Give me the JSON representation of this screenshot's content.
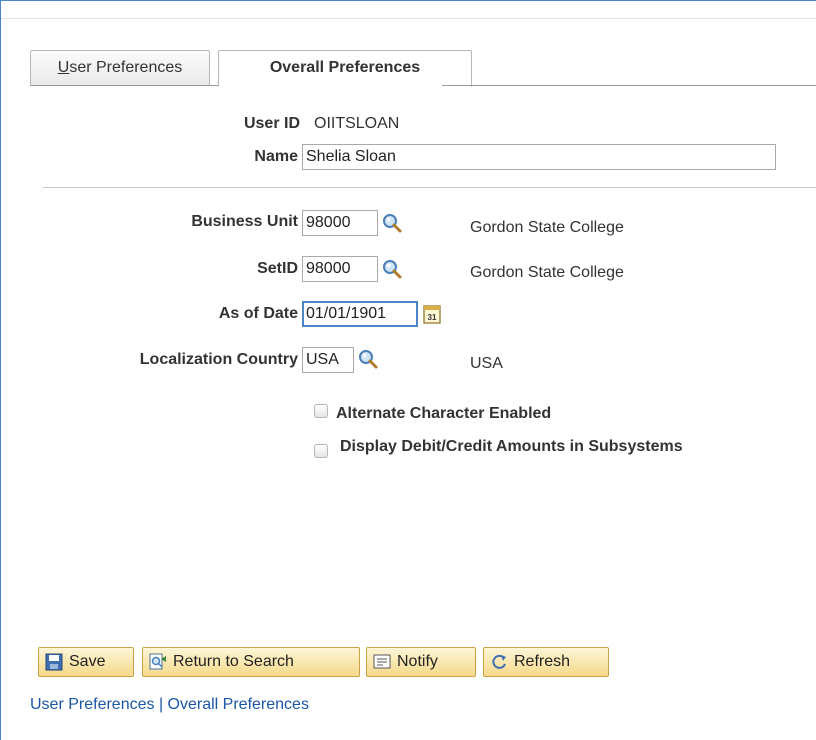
{
  "tabs": {
    "user_preferences": "User Preferences",
    "user_preferences_first": "U",
    "user_preferences_rest": "ser Preferences",
    "overall_preferences": "Overall Preferences"
  },
  "user": {
    "user_id_label": "User ID",
    "user_id_value": "OIITSLOAN",
    "name_label": "Name",
    "name_value": "Shelia Sloan"
  },
  "fields": {
    "business_unit_label": "Business Unit",
    "business_unit_value": "98000",
    "business_unit_desc": "Gordon State College",
    "setid_label": "SetID",
    "setid_value": "98000",
    "setid_desc": "Gordon State College",
    "as_of_date_label": "As of Date",
    "as_of_date_value": "01/01/1901",
    "localization_label": "Localization Country",
    "localization_value": "USA",
    "localization_desc": "USA"
  },
  "checkboxes": {
    "alternate_character": {
      "label": "Alternate Character Enabled",
      "checked": false
    },
    "display_debit_credit": {
      "label": "Display Debit/Credit Amounts in Subsystems",
      "checked": false
    }
  },
  "toolbar": {
    "save": "Save",
    "return_to_search": "Return to Search",
    "notify": "Notify",
    "refresh": "Refresh"
  },
  "footer": {
    "link1": "User Preferences",
    "separator": " | ",
    "link2": "Overall Preferences"
  },
  "icons": {
    "lookup": "magnifier-icon",
    "calendar": "calendar-icon",
    "save": "save-icon",
    "return": "return-to-search-icon",
    "notify": "notify-icon",
    "refresh": "refresh-icon"
  },
  "colors": {
    "accent": "#4a86c8",
    "link": "#1a57a5",
    "button_top": "#fff6d8",
    "button_bottom": "#f5d98a"
  }
}
